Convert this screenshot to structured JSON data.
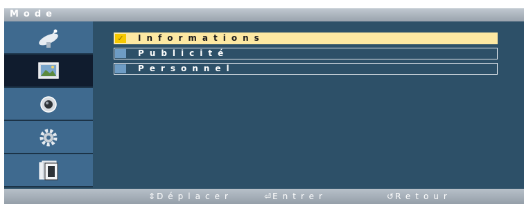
{
  "title": "Mode",
  "sidebar": {
    "items": [
      {
        "icon": "satellite-dish-icon"
      },
      {
        "icon": "picture-icon",
        "active": true
      },
      {
        "icon": "speaker-icon"
      },
      {
        "icon": "gear-icon"
      },
      {
        "icon": "multi-screen-icon"
      }
    ]
  },
  "menu": {
    "items": [
      {
        "label": "Informations",
        "marker": "✓",
        "selected": true
      },
      {
        "label": "Publicité",
        "marker": ""
      },
      {
        "label": "Personnel",
        "marker": ""
      }
    ]
  },
  "footer": {
    "move_icon": "⇕",
    "move_label": "Déplacer",
    "enter_icon": "⏎",
    "enter_label": "Entrer",
    "return_icon": "↺",
    "return_label": "Retour"
  },
  "colors": {
    "background": "#2d5068",
    "sidebar": "#3f6a8f",
    "sidebar_active": "#101c2e",
    "selected_row": "#fde8a2",
    "selected_marker": "#f6c800"
  }
}
